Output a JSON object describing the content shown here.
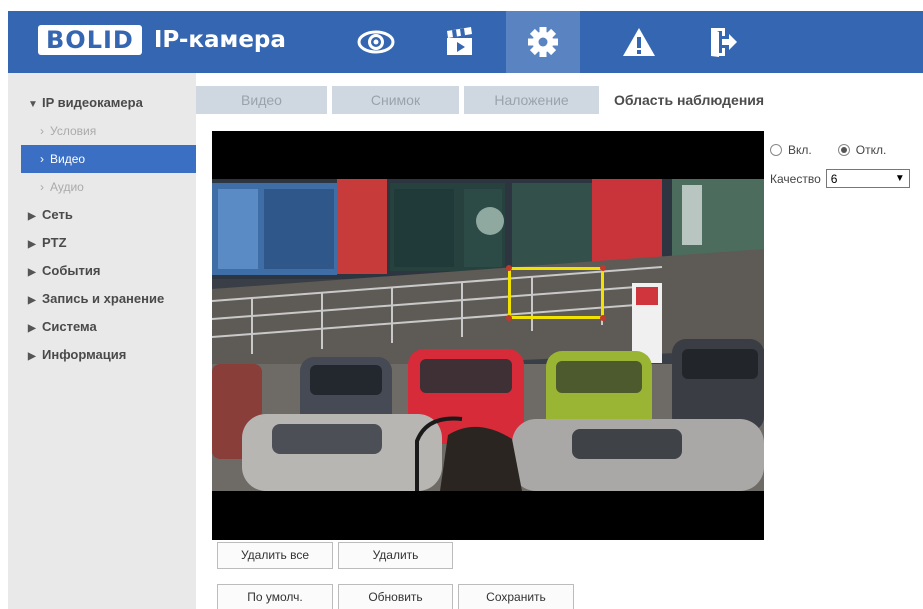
{
  "header": {
    "logo_brand": "BOLID",
    "logo_product": "IP-камера",
    "nav": [
      {
        "icon": "eye-icon",
        "active": false
      },
      {
        "icon": "clapperboard-icon",
        "active": false
      },
      {
        "icon": "gear-icon",
        "active": true
      },
      {
        "icon": "warning-icon",
        "active": false
      },
      {
        "icon": "exit-icon",
        "active": false
      }
    ]
  },
  "sidebar": {
    "section_ip": "IP видеокамера",
    "sub_conditions": "Условия",
    "sub_video": "Видео",
    "sub_audio": "Аудио",
    "network": "Сеть",
    "ptz": "PTZ",
    "events": "События",
    "recording": "Запись и хранение",
    "system": "Система",
    "info": "Информация"
  },
  "tabs": {
    "video": "Видео",
    "snapshot": "Снимок",
    "overlay": "Наложение",
    "roi": "Область наблюдения"
  },
  "controls": {
    "on_label": "Вкл.",
    "off_label": "Откл.",
    "selected": "off",
    "quality_label": "Качество",
    "quality_value": "6"
  },
  "buttons": {
    "delete_all": "Удалить все",
    "delete": "Удалить",
    "default": "По умолч.",
    "refresh": "Обновить",
    "save": "Сохранить"
  },
  "colors": {
    "header_bg": "#3566b1",
    "active_nav": "#5a83c2",
    "sidebar_active": "#3a6fc4",
    "roi_border": "#f2e200"
  }
}
